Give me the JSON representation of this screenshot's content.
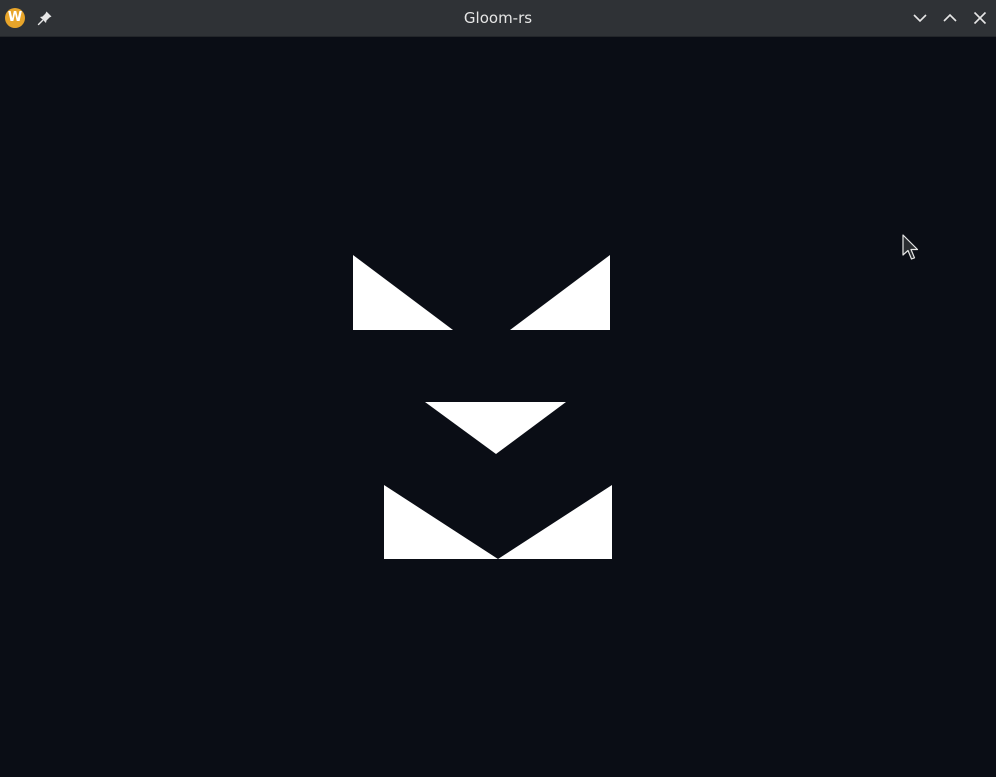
{
  "window": {
    "title": "Gloom-rs",
    "app_icon_letter": "W",
    "buttons": {
      "pin": "pin-icon",
      "minimize": "chevron-down-icon",
      "maximize": "chevron-up-icon",
      "close": "close-icon"
    }
  },
  "colors": {
    "titlebar": "#2f3236",
    "title_text": "#e6e6e6",
    "app_icon": "#e8a52a",
    "canvas_background": "#0a0d15",
    "shapes": "#ffffff"
  },
  "scene": {
    "shapes": [
      "left-eye-triangle",
      "right-eye-triangle",
      "nose-triangle",
      "mouth-left-triangle",
      "mouth-right-triangle"
    ]
  }
}
